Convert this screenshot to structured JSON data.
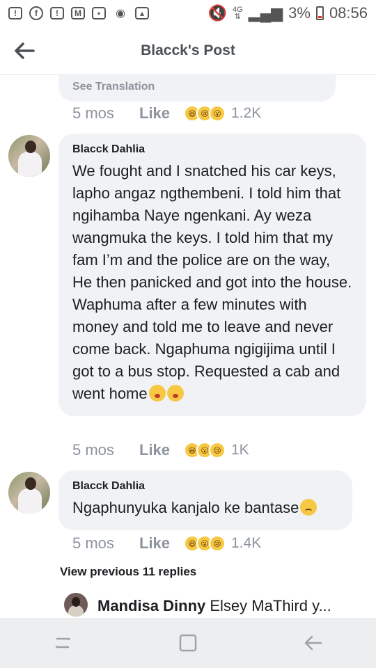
{
  "status_bar": {
    "network": "4G",
    "battery": "3%",
    "time": "08:56"
  },
  "header": {
    "title": "Blacck's Post"
  },
  "top_comment": {
    "see_translation": "See Translation",
    "time": "5 mos",
    "like": "Like",
    "reaction_count": "1.2K"
  },
  "comments": [
    {
      "author": "Blacck Dahlia",
      "text": "We fought and I snatched his car keys, lapho angaz ngthembeni. I told him that ngihamba Naye ngenkani. Ay weza wangmuka the keys. I told him that my fam I’m and the police are on the way, He then panicked and got into the house. Waphuma after a few minutes with money and told me to leave and never come back. Ngaphuma ngigijima until I got to a bus stop. Requested a cab and went home",
      "time": "5 mos",
      "like": "Like",
      "reaction_count": "1K"
    },
    {
      "author": "Blacck Dahlia",
      "text": "Ngaphunyuka kanjalo ke bantase",
      "time": "5 mos",
      "like": "Like",
      "reaction_count": "1.4K"
    }
  ],
  "view_previous": "View previous 11 replies",
  "reply_preview": {
    "name": "Mandisa Dinny",
    "text": "Elsey MaThird y..."
  },
  "icons": {
    "back": "back-arrow-icon",
    "reactions": [
      "haha-icon",
      "sad-icon",
      "wow-icon"
    ]
  },
  "colors": {
    "bubble": "#f0f2f5",
    "meta": "#8d949e",
    "reaction": "#f7c843"
  }
}
